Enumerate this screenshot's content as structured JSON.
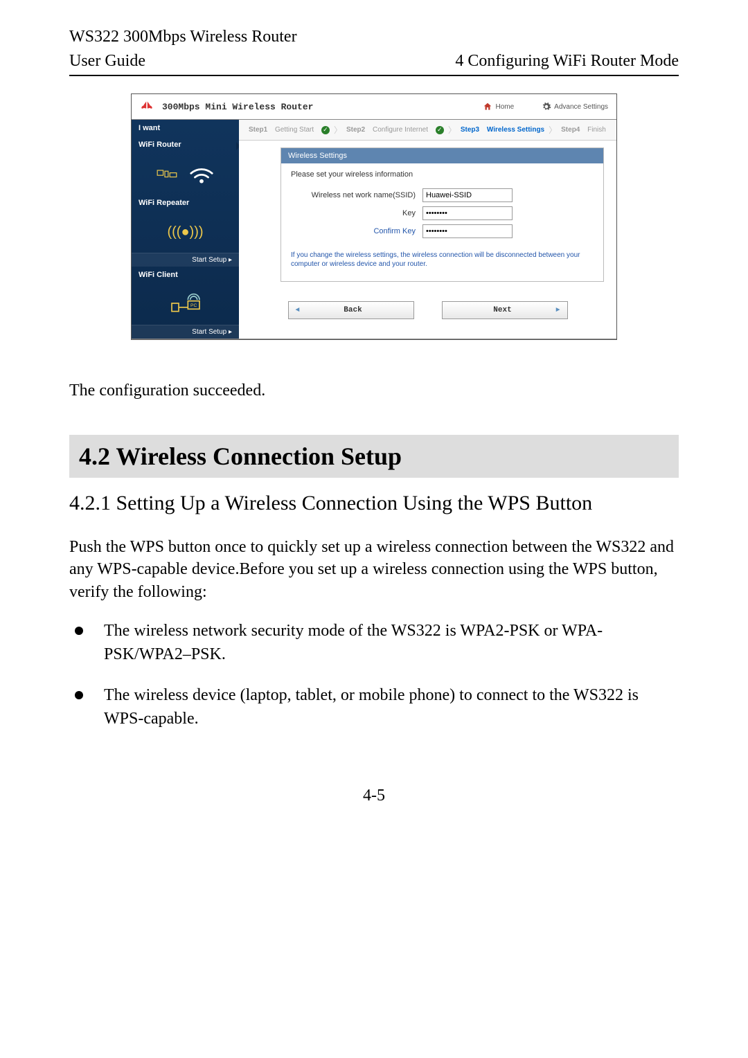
{
  "doc": {
    "product": "WS322 300Mbps Wireless Router",
    "left_header": "User Guide",
    "right_header": "4 Configuring WiFi Router Mode",
    "config_ok": "The configuration succeeded.",
    "section_number_title": "4.2 Wireless Connection Setup",
    "subsection_title": "4.2.1 Setting Up a Wireless Connection Using the WPS Button",
    "intro": "Push the WPS button once to quickly set up a wireless connection between the WS322 and any WPS-capable device.Before you set up a wireless connection using the WPS button, verify the following:",
    "bullet1": "The wireless network security mode of the WS322 is WPA2-PSK or WPA-PSK/WPA2–PSK.",
    "bullet2": "The wireless device (laptop, tablet, or mobile phone) to connect to the WS322 is WPS-capable.",
    "page_number": "4-5"
  },
  "ui": {
    "title": "300Mbps Mini Wireless Router",
    "home_btn": "Home",
    "adv_btn": "Advance Settings",
    "sidebar": {
      "title": "I want",
      "router": "WiFi Router",
      "repeater": "WiFi Repeater",
      "client": "WiFi Client",
      "start": "Start Setup ▸"
    },
    "steps": {
      "s1b": "Step1",
      "s1": "Getting Start",
      "s2b": "Step2",
      "s2": "Configure Internet",
      "s3b": "Step3",
      "s3": "Wireless Settings",
      "s4b": "Step4",
      "s4": "Finish"
    },
    "panel": {
      "title": "Wireless Settings",
      "hint": "Please set your wireless information",
      "ssid_label": "Wireless net work name(SSID)",
      "ssid_value": "Huawei-SSID",
      "key_label": "Key",
      "key_value": "••••••••",
      "confirm_label": "Confirm Key",
      "confirm_value": "••••••••",
      "note": "If you change the wireless settings, the wireless connection will be disconnected between your computer or wireless device and your router."
    },
    "nav": {
      "back": "Back",
      "next": "Next"
    }
  }
}
